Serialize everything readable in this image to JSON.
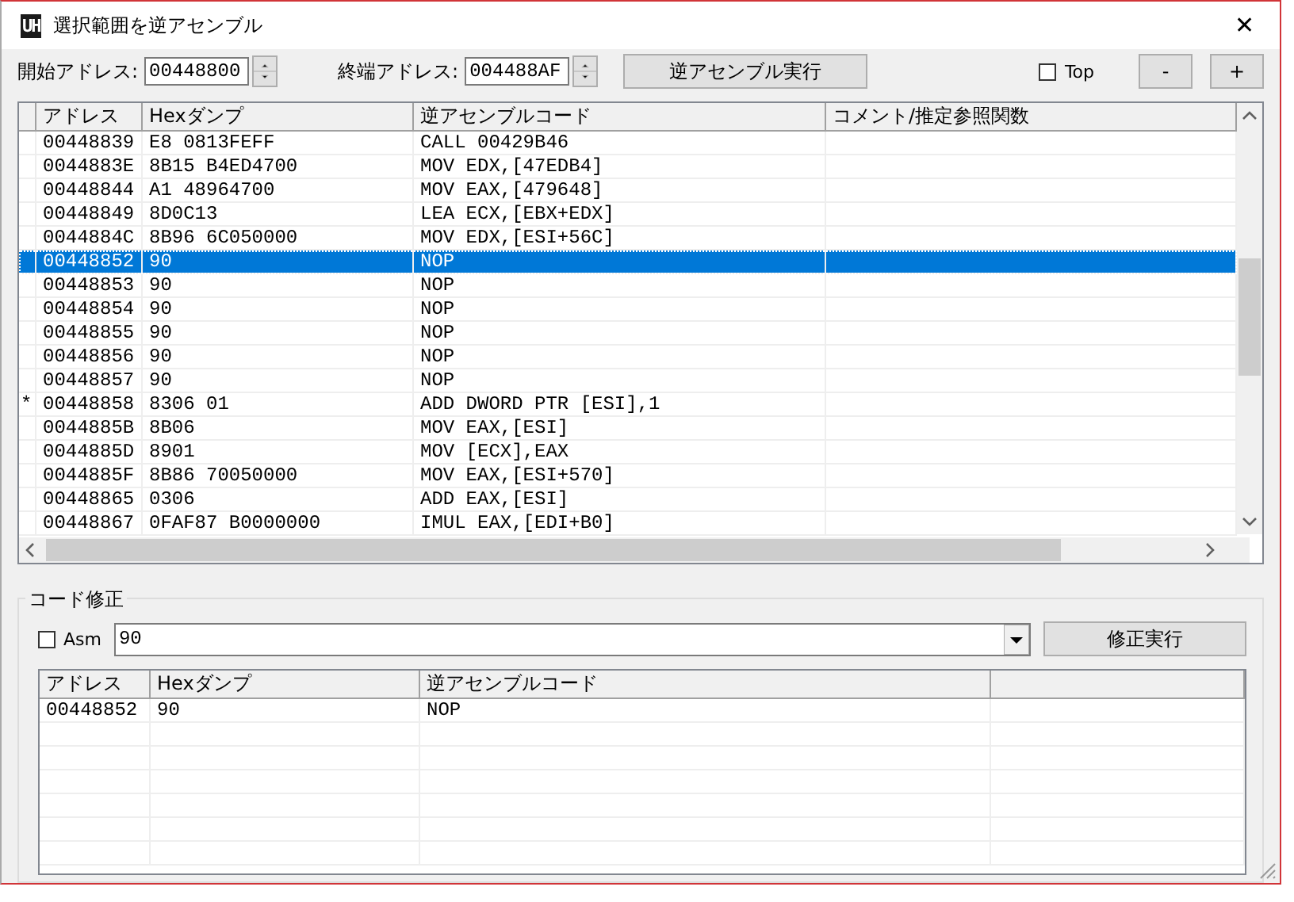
{
  "window": {
    "title": "選択範囲を逆アセンブル",
    "logo": "UH",
    "close": "✕"
  },
  "toolbar": {
    "start_label": "開始アドレス:",
    "start_value": "00448800",
    "end_label": "終端アドレス:",
    "end_value": "004488AF",
    "disassemble_button": "逆アセンブル実行",
    "top_checkbox": {
      "label": "Top",
      "checked": false
    },
    "minus_button": "-",
    "plus_button": "+"
  },
  "listing": {
    "columns": [
      "アドレス",
      "Hexダンプ",
      "逆アセンブルコード",
      "コメント/推定参照関数"
    ],
    "rows": [
      {
        "marker": "",
        "address": "00448839",
        "hex": "E8 0813FEFF",
        "code": "CALL 00429B46",
        "selected": false
      },
      {
        "marker": "",
        "address": "0044883E",
        "hex": "8B15 B4ED4700",
        "code": "MOV EDX,[47EDB4]",
        "selected": false
      },
      {
        "marker": "",
        "address": "00448844",
        "hex": "A1 48964700",
        "code": "MOV EAX,[479648]",
        "selected": false
      },
      {
        "marker": "",
        "address": "00448849",
        "hex": "8D0C13",
        "code": "LEA ECX,[EBX+EDX]",
        "selected": false
      },
      {
        "marker": "",
        "address": "0044884C",
        "hex": "8B96 6C050000",
        "code": "MOV EDX,[ESI+56C]",
        "selected": false
      },
      {
        "marker": "",
        "address": "00448852",
        "hex": "90",
        "code": "NOP",
        "selected": true
      },
      {
        "marker": "",
        "address": "00448853",
        "hex": "90",
        "code": "NOP",
        "selected": false
      },
      {
        "marker": "",
        "address": "00448854",
        "hex": "90",
        "code": "NOP",
        "selected": false
      },
      {
        "marker": "",
        "address": "00448855",
        "hex": "90",
        "code": "NOP",
        "selected": false
      },
      {
        "marker": "",
        "address": "00448856",
        "hex": "90",
        "code": "NOP",
        "selected": false
      },
      {
        "marker": "",
        "address": "00448857",
        "hex": "90",
        "code": "NOP",
        "selected": false
      },
      {
        "marker": "*",
        "address": "00448858",
        "hex": "8306 01",
        "code": "ADD DWORD PTR [ESI],1",
        "selected": false
      },
      {
        "marker": "",
        "address": "0044885B",
        "hex": "8B06",
        "code": "MOV EAX,[ESI]",
        "selected": false
      },
      {
        "marker": "",
        "address": "0044885D",
        "hex": "8901",
        "code": "MOV [ECX],EAX",
        "selected": false
      },
      {
        "marker": "",
        "address": "0044885F",
        "hex": "8B86 70050000",
        "code": "MOV EAX,[ESI+570]",
        "selected": false
      },
      {
        "marker": "",
        "address": "00448865",
        "hex": "0306",
        "code": "ADD EAX,[ESI]",
        "selected": false
      },
      {
        "marker": "",
        "address": "00448867",
        "hex": "0FAF87 B0000000",
        "code": "IMUL EAX,[EDI+B0]",
        "selected": false
      }
    ]
  },
  "code_edit": {
    "title": "コード修正",
    "asm_checkbox": {
      "label": "Asm",
      "checked": false
    },
    "input_value": "90",
    "apply_button": "修正実行",
    "columns": [
      "アドレス",
      "Hexダンプ",
      "逆アセンブルコード"
    ],
    "rows": [
      {
        "address": "00448852",
        "hex": "90",
        "code": "NOP"
      }
    ]
  }
}
